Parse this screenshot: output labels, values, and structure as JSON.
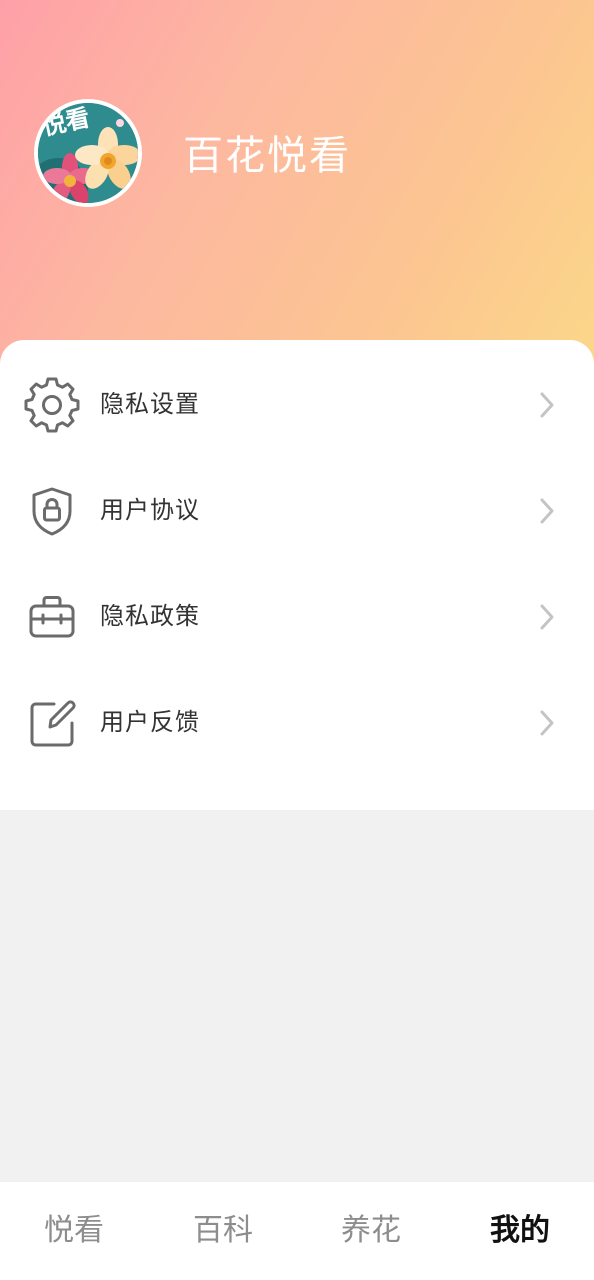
{
  "profile": {
    "app_name": "百花悦看",
    "avatar_text": "悦看"
  },
  "menu": {
    "items": [
      {
        "label": "隐私设置",
        "icon": "gear-icon"
      },
      {
        "label": "用户协议",
        "icon": "shield-lock-icon"
      },
      {
        "label": "隐私政策",
        "icon": "briefcase-icon"
      },
      {
        "label": "用户反馈",
        "icon": "edit-icon"
      }
    ]
  },
  "tabbar": {
    "tabs": [
      {
        "label": "悦看",
        "active": false
      },
      {
        "label": "百科",
        "active": false
      },
      {
        "label": "养花",
        "active": false
      },
      {
        "label": "我的",
        "active": true
      }
    ]
  },
  "colors": {
    "header_gradient_start": "#fea0a8",
    "header_gradient_end": "#fbd889",
    "icon_gray": "#6b6b6b",
    "chevron_gray": "#c4c4c4",
    "tab_inactive": "#8d8d8d",
    "tab_active": "#111111"
  }
}
